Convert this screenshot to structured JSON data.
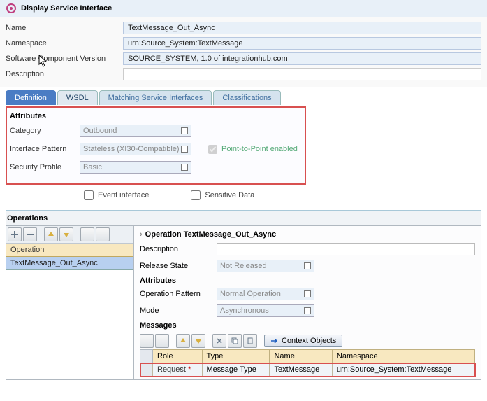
{
  "header": {
    "title": "Display Service Interface"
  },
  "fields": {
    "name_label": "Name",
    "name_value": "TextMessage_Out_Async",
    "namespace_label": "Namespace",
    "namespace_value": "urn:Source_System:TextMessage",
    "scv_label": "Software Component Version",
    "scv_value": "SOURCE_SYSTEM, 1.0 of integrationhub.com",
    "desc_label": "Description",
    "desc_value": ""
  },
  "tabs": {
    "definition": "Definition",
    "wsdl": "WSDL",
    "matching": "Matching Service Interfaces",
    "classifications": "Classifications"
  },
  "attributes": {
    "title": "Attributes",
    "category_label": "Category",
    "category_value": "Outbound",
    "pattern_label": "Interface Pattern",
    "pattern_value": "Stateless (XI30-Compatible)",
    "p2p_label": "Point-to-Point enabled",
    "security_label": "Security Profile",
    "security_value": "Basic"
  },
  "flags": {
    "event_label": "Event interface",
    "sensitive_label": "Sensitive Data"
  },
  "operations": {
    "title": "Operations",
    "col_header": "Operation",
    "item": "TextMessage_Out_Async"
  },
  "operation_detail": {
    "header": "Operation TextMessage_Out_Async",
    "desc_label": "Description",
    "release_label": "Release State",
    "release_value": "Not Released",
    "attributes_title": "Attributes",
    "op_pattern_label": "Operation Pattern",
    "op_pattern_value": "Normal Operation",
    "mode_label": "Mode",
    "mode_value": "Asynchronous",
    "messages_title": "Messages",
    "context_objects": "Context Objects",
    "columns": {
      "role": "Role",
      "type": "Type",
      "name": "Name",
      "namespace": "Namespace"
    },
    "row": {
      "role": "Request",
      "req_mark": "*",
      "type": "Message Type",
      "name": "TextMessage",
      "namespace": "urn:Source_System:TextMessage"
    }
  }
}
